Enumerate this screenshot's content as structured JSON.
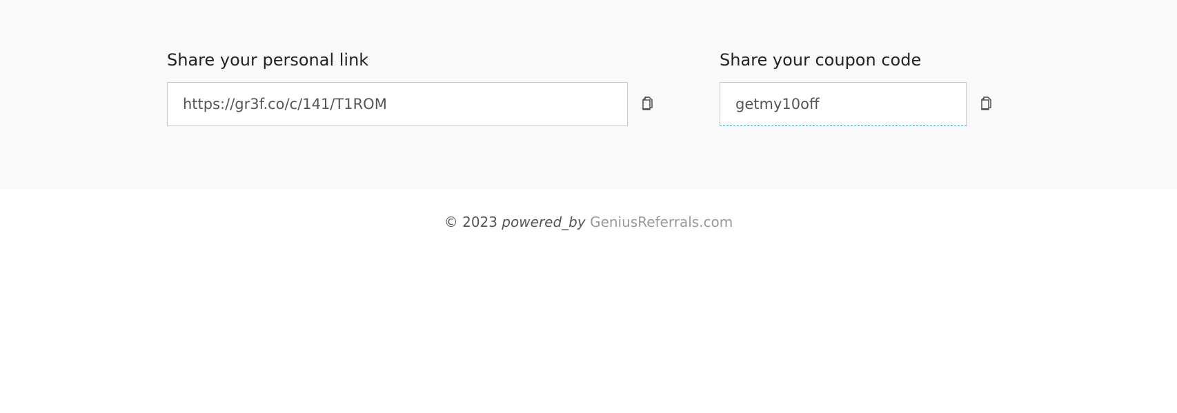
{
  "share": {
    "link": {
      "heading": "Share your personal link",
      "value": "https://gr3f.co/c/141/T1ROM",
      "copy_icon": "copy-icon"
    },
    "coupon": {
      "heading": "Share your coupon code",
      "value": "getmy10off",
      "copy_icon": "copy-icon"
    }
  },
  "footer": {
    "copyright": "© 2023",
    "powered_by": "powered_by",
    "brand": "GeniusReferrals.com"
  },
  "colors": {
    "band_background": "#f9f9f9",
    "field_border": "#c9c9c9",
    "focus_dashed": "#2f9fd0",
    "brand_link": "#999999"
  }
}
